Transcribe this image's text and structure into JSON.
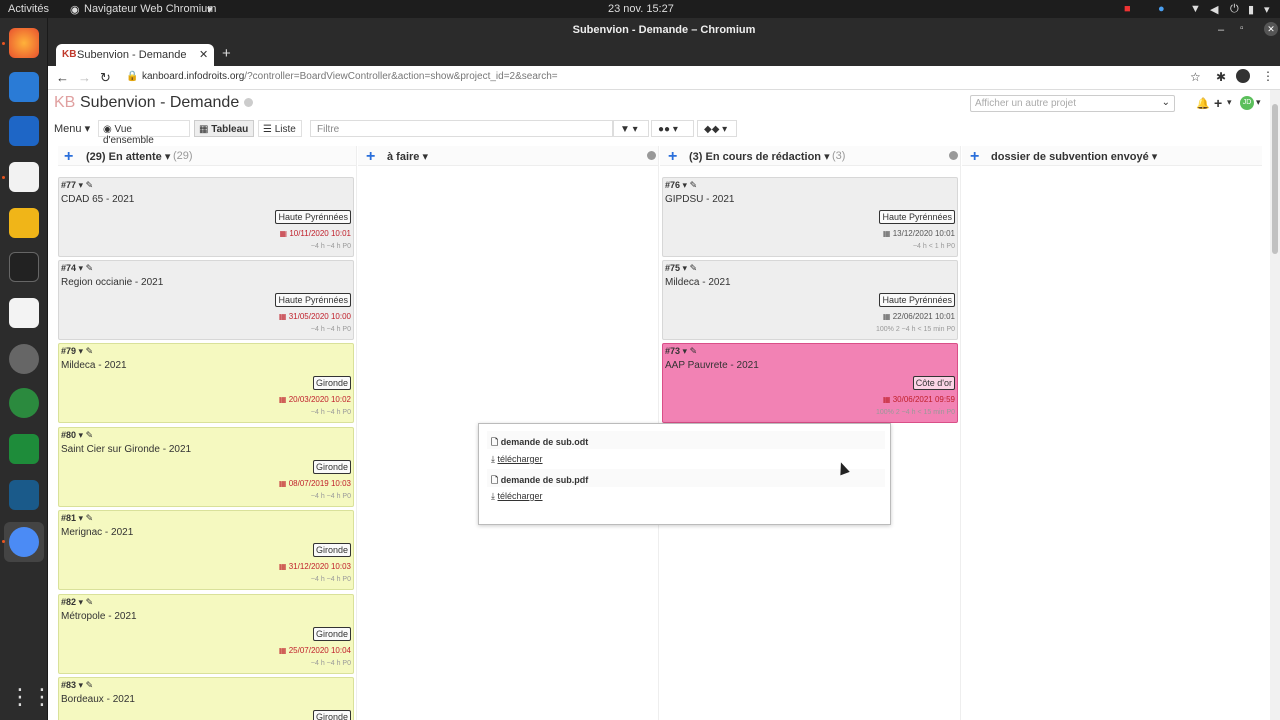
{
  "gnome": {
    "activities": "Activités",
    "app_menu": "Navigateur Web Chromium",
    "clock": "23 nov.  15:27"
  },
  "browser": {
    "window_title": "Subenvion - Demande – Chromium",
    "tab_title": "Subenvion - Demande",
    "url_host": "kanboard.infodroits.org",
    "url_path": "/?controller=BoardViewController&action=show&project_id=2&search="
  },
  "project": {
    "logo": "KB",
    "title": "Subenvion - Demande",
    "switch_placeholder": "Afficher un autre projet"
  },
  "toolbar": {
    "menu": "Menu",
    "overview": "Vue d'ensemble",
    "board": "Tableau",
    "list": "Liste",
    "filter_placeholder": "Filtre"
  },
  "columns": [
    {
      "title": "(29) En attente",
      "count": "(29)"
    },
    {
      "title": "à faire",
      "count": ""
    },
    {
      "title": "(3) En cours de rédaction",
      "count": "(3)"
    },
    {
      "title": "dossier de subvention envoyé",
      "count": ""
    }
  ],
  "cards_col1": [
    {
      "id": "#77",
      "title": "CDAD 65 - 2021",
      "category": "Haute Pyrénnées",
      "due": "10/11/2020 10:01",
      "meta": "~4 h  ~4 h  P0",
      "color": "grey"
    },
    {
      "id": "#74",
      "title": "Region occianie - 2021",
      "category": "Haute Pyrénnées",
      "due": "31/05/2020 10:00",
      "meta": "~4 h  ~4 h  P0",
      "color": "grey"
    },
    {
      "id": "#79",
      "title": "Mildeca - 2021",
      "category": "Gironde",
      "due": "20/03/2020 10:02",
      "meta": "~4 h  ~4 h  P0",
      "color": "yel"
    },
    {
      "id": "#80",
      "title": "Saint Cier sur Gironde - 2021",
      "category": "Gironde",
      "due": "08/07/2019 10:03",
      "meta": "~4 h  ~4 h  P0",
      "color": "yel"
    },
    {
      "id": "#81",
      "title": "Merignac - 2021",
      "category": "Gironde",
      "due": "31/12/2020 10:03",
      "meta": "~4 h  ~4 h  P0",
      "color": "yel"
    },
    {
      "id": "#82",
      "title": "Métropole - 2021",
      "category": "Gironde",
      "due": "25/07/2020 10:04",
      "meta": "~4 h  ~4 h  P0",
      "color": "yel"
    },
    {
      "id": "#83",
      "title": "Bordeaux - 2021",
      "category": "Gironde",
      "due": "",
      "meta": "",
      "color": "yel"
    }
  ],
  "cards_col3": [
    {
      "id": "#76",
      "title": "GIPDSU - 2021",
      "category": "Haute Pyrénnées",
      "due": "13/12/2020 10:01",
      "meta": "~4 h  < 1 h  P0",
      "color": "grey"
    },
    {
      "id": "#75",
      "title": "Mildeca - 2021",
      "category": "Haute Pyrénnées",
      "due": "22/06/2021 10:01",
      "meta": "100%  2  ~4 h  < 15 min  P0",
      "color": "grey"
    },
    {
      "id": "#73",
      "title": "AAP Pauvrete - 2021",
      "category": "Côte d'or",
      "due": "30/06/2021 09:59",
      "meta": "100%  2  ~4 h  < 15 min  P0",
      "color": "pink"
    }
  ],
  "attachments": [
    {
      "name": "demande de sub.odt",
      "action": "télécharger"
    },
    {
      "name": "demande de sub.pdf",
      "action": "télécharger"
    }
  ]
}
